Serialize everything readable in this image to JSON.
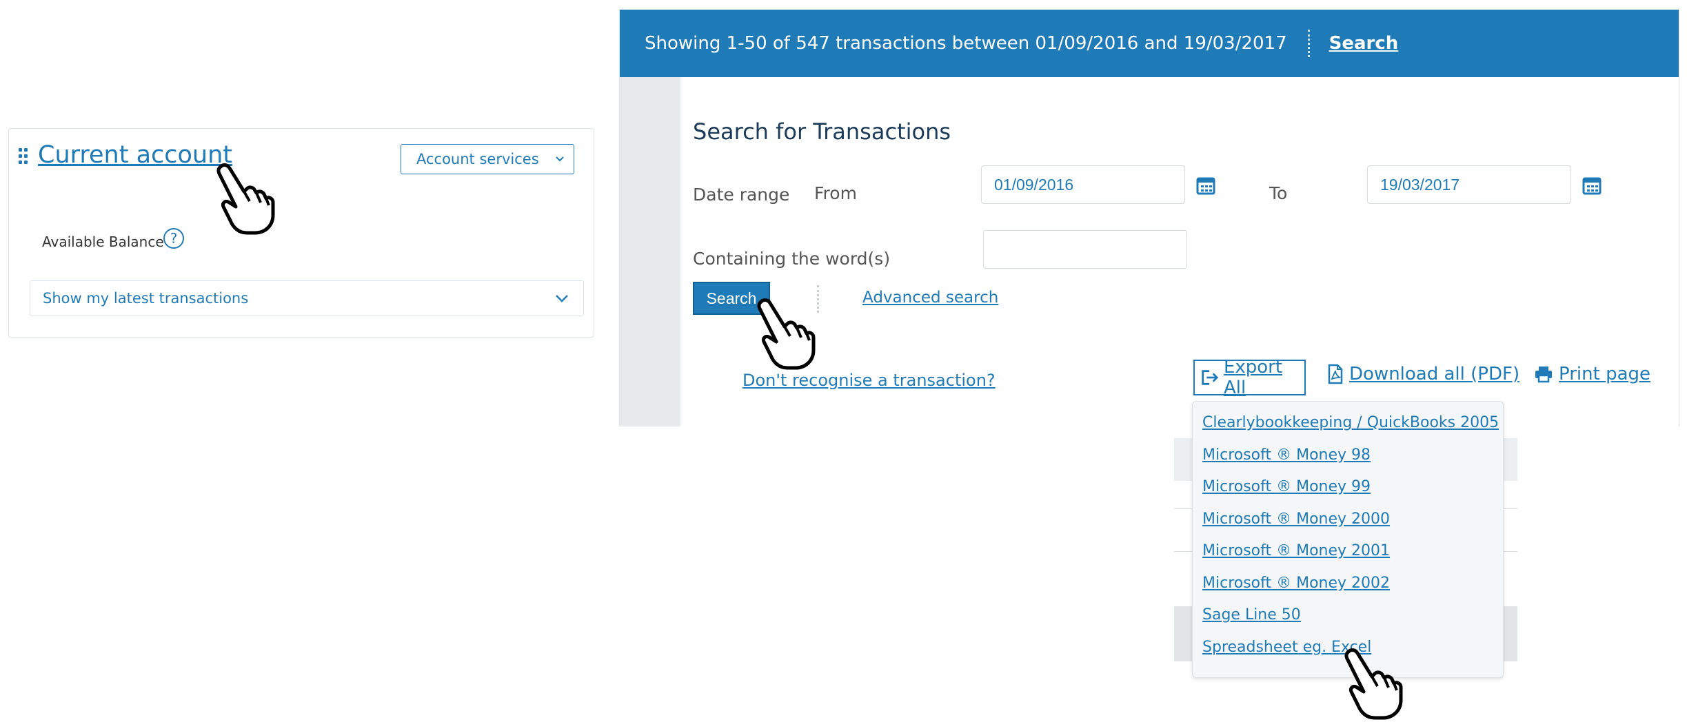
{
  "account_panel": {
    "title": "Current account",
    "services_button": "Account services",
    "available_balance_label": "Available Balance",
    "help_icon_glyph": "?",
    "latest_transactions": "Show my latest transactions"
  },
  "transactions": {
    "header_summary": "Showing 1-50 of 547 transactions between 01/09/2016 and 19/03/2017",
    "header_search_link": "Search",
    "search_heading": "Search for Transactions",
    "date_range_label": "Date range",
    "from_label": "From",
    "from_value": "01/09/2016",
    "to_label": "To",
    "to_value": "19/03/2017",
    "words_label": "Containing the word(s)",
    "words_value": "",
    "search_button": "Search",
    "advanced_search": "Advanced search",
    "dont_recognise": "Don't recognise a transaction?",
    "export_all": "Export All",
    "download_all": "Download all (PDF)",
    "print_page": "Print page"
  },
  "export_menu": {
    "items": [
      "Clearlybookkeeping / QuickBooks 2005",
      "Microsoft ® Money 98",
      "Microsoft ® Money 99",
      "Microsoft ® Money 2000",
      "Microsoft ® Money 2001",
      "Microsoft ® Money 2002",
      "Sage Line 50",
      "Spreadsheet eg. Excel"
    ]
  },
  "colors": {
    "accent": "#1e7bb8",
    "header_bg": "#1e7bb8",
    "side_strip": "#e7eaec"
  },
  "icons": [
    "drag-handle-icon",
    "chevron-down-icon",
    "help-icon",
    "calendar-icon",
    "export-icon",
    "pdf-icon",
    "printer-icon",
    "hand-pointer-icon"
  ]
}
